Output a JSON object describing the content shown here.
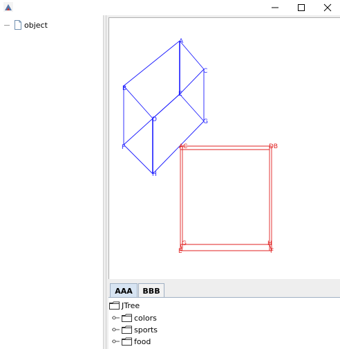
{
  "window": {
    "app_icon": "java-app-icon"
  },
  "left_tree": {
    "root_label": "object",
    "root_icon": "document-icon"
  },
  "diagram": {
    "colors": {
      "blue": "#1a1aff",
      "red": "#e02020"
    },
    "blue_labels": [
      "A",
      "B",
      "C",
      "E",
      "D",
      "G",
      "F",
      "H"
    ],
    "red_labels": [
      "AC",
      "DB",
      "G",
      "H",
      "E",
      "F"
    ]
  },
  "tabs": [
    {
      "label": "AAA"
    },
    {
      "label": "BBB"
    }
  ],
  "jtree": {
    "root": "JTree",
    "children": [
      {
        "label": "colors"
      },
      {
        "label": "sports"
      },
      {
        "label": "food"
      }
    ]
  }
}
